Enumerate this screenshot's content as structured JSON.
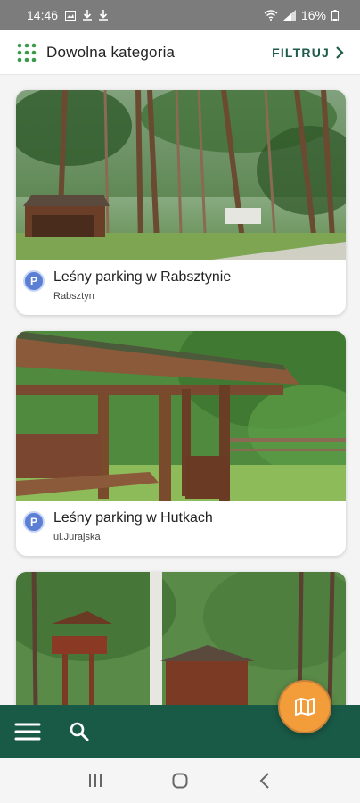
{
  "status_bar": {
    "time": "14:46",
    "battery": "16%",
    "icons": [
      "image-icon",
      "download-icon",
      "download-icon",
      "wifi-icon",
      "signal-icon",
      "battery-icon"
    ]
  },
  "header": {
    "category": "Dowolna kategoria",
    "filter_label": "FILTRUJ",
    "icons": [
      "grid-icon",
      "chevron-right-icon"
    ]
  },
  "places": [
    {
      "title": "Leśny parking w Rabsztynie",
      "subtitle": "Rabsztyn",
      "badge": "P",
      "icon": "parking-icon"
    },
    {
      "title": "Leśny parking w Hutkach",
      "subtitle": "ul.Jurajska",
      "badge": "P",
      "icon": "parking-icon"
    }
  ],
  "bottom_bar": {
    "icons": [
      "menu-icon",
      "search-icon",
      "map-icon"
    ]
  },
  "colors": {
    "primary": "#195a46",
    "accent": "#f39c3a",
    "parking_badge": "#5b7fd4",
    "filter_text": "#1d5b4a"
  }
}
